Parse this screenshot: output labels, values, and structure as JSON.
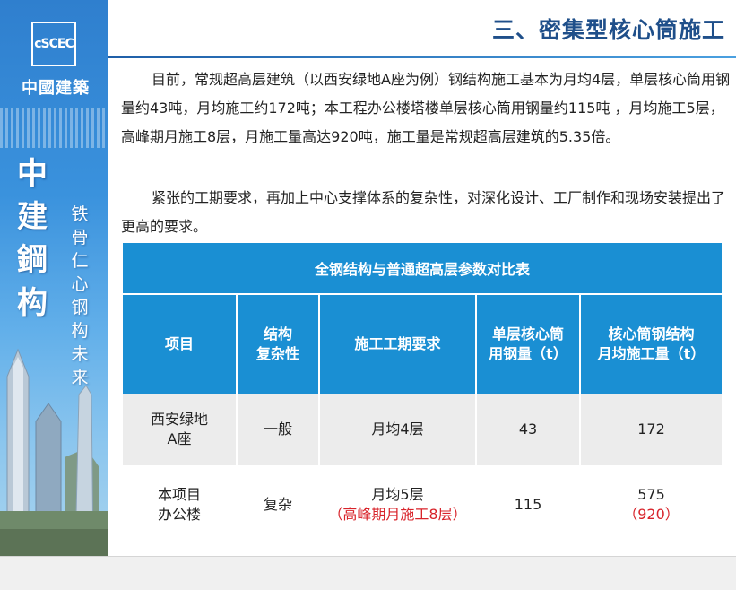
{
  "brand": {
    "logo_text": "cSCEC",
    "company_name": "中國建築",
    "big_characters": [
      "中",
      "建",
      "鋼",
      "构"
    ],
    "slogan_characters": [
      "铁",
      "骨",
      "仁",
      "心",
      "钢",
      "构",
      "未",
      "来"
    ]
  },
  "header": {
    "title": "三、密集型核心筒施工"
  },
  "body": {
    "paragraph_1": "目前，常规超高层建筑（以西安绿地A座为例）钢结构施工基本为月均4层，单层核心筒用钢量约43吨，月均施工约172吨；本工程办公楼塔楼单层核心筒用钢量约115吨 ，月均施工5层，高峰期月施工8层，月施工量高达920吨，施工量是常规超高层建筑的5.35倍。",
    "paragraph_2": "紧张的工期要求，再加上中心支撑体系的复杂性，对深化设计、工厂制作和现场安装提出了更高的要求。"
  },
  "table": {
    "caption": "全钢结构与普通超高层参数对比表",
    "headers": {
      "item": "项目",
      "complexity_line1": "结构",
      "complexity_line2": "复杂性",
      "schedule": "施工工期要求",
      "steel_line1": "单层核心筒",
      "steel_line2": "用钢量（t）",
      "monthly_line1": "核心筒钢结构",
      "monthly_line2": "月均施工量（t）"
    },
    "rows": [
      {
        "item_line1": "西安绿地",
        "item_line2": "A座",
        "complexity": "一般",
        "schedule": "月均4层",
        "steel": "43",
        "monthly": "172"
      },
      {
        "item_line1": "本项目",
        "item_line2": "办公楼",
        "complexity": "复杂",
        "schedule": "月均5层",
        "schedule_peak": "（高峰期月施工8层）",
        "steel": "115",
        "monthly": "575",
        "monthly_peak": "（920）"
      }
    ]
  },
  "colors": {
    "table_header_blue": "#1a8fd3",
    "title_blue": "#1f4f8a",
    "highlight_red": "#d8232a",
    "row_gray": "#ececec"
  }
}
